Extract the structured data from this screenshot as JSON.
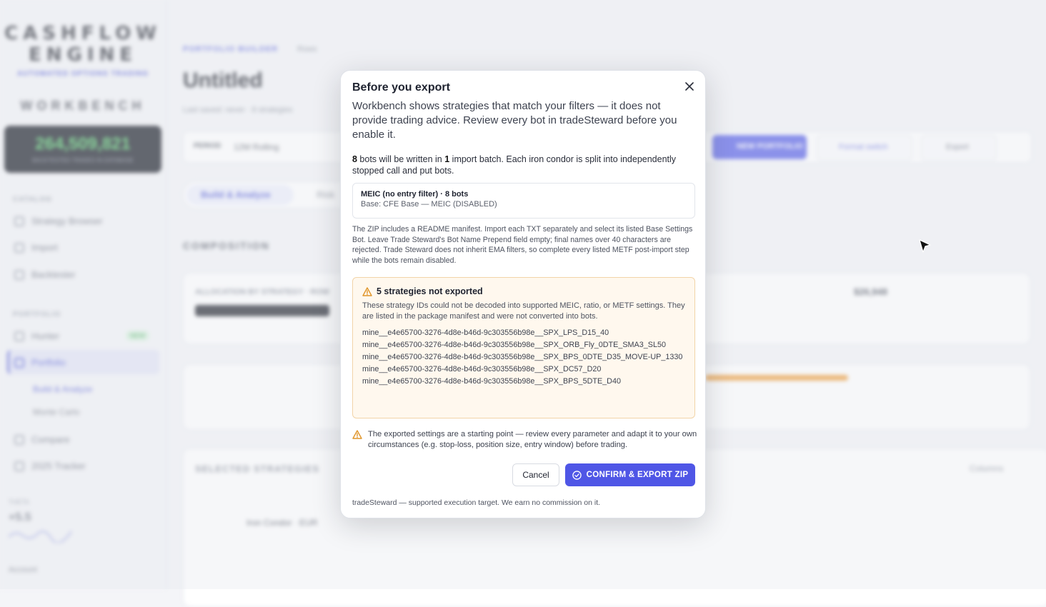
{
  "sidebar": {
    "logo_line1": "CASHFLOW",
    "logo_line2": "ENGINE",
    "logo_tag": "AUTOMATED OPTIONS TRADING",
    "workbench": "WORKBENCH",
    "counter_value": "264,509,821",
    "counter_sub": "BACKTESTED TRADES IN DATABASE",
    "section_catalog": "CATALOG",
    "section_portfolio": "PORTFOLIO",
    "items": [
      {
        "label": "Strategy Browser"
      },
      {
        "label": "Import"
      },
      {
        "label": "Backtester"
      },
      {
        "label": "Hunter"
      },
      {
        "label": "Portfolio"
      },
      {
        "label": "Compare"
      },
      {
        "label": "2025 Tracker"
      }
    ],
    "sub_items": [
      "Build & Analyze",
      "Monte Carlo"
    ],
    "new_badge": "NEW",
    "theta_label": "THETA",
    "theta_value": "+5.5",
    "account_label": "Account"
  },
  "main": {
    "breadcrumb": "PORTFOLIO BUILDER",
    "breadcrumb_sub": "Rows",
    "title": "Untitled",
    "meta": "Last saved: never · 8 strategies",
    "toolbar_period_label": "PERIOD",
    "toolbar_period_value": "12M Rolling",
    "toolbar_new_portfolio": "NEW PORTFOLIO",
    "toolbar_format": "Format switch",
    "toolbar_export": "Export",
    "tab_build": "Build & Analyze",
    "tab_other": "Risk",
    "section_composition": "COMPOSITION",
    "allocation_label": "ALLOCATION BY STRATEGY · ROW",
    "allocation_total": "$26,948",
    "section_selected": "SELECTED STRATEGIES",
    "columns_btn": "Columns",
    "row_group": "Iron Condor · EUR"
  },
  "modal": {
    "title": "Before you export",
    "lead": "Workbench shows strategies that match your filters — it does not provide trading advice. Review every bot in tradeSteward before you enable it.",
    "bot_count": "8",
    "batch_count": "1",
    "batch_text_1": " bots will be written in ",
    "batch_text_2": " import batch. Each iron condor is split into independently stopped call and put bots.",
    "bot_name": "MEIC (no entry filter) · 8 bots",
    "bot_base": "Base: CFE Base — MEIC (DISABLED)",
    "zip_note": "The ZIP includes a README manifest. Import each TXT separately and select its listed Base Settings Bot. Leave Trade Steward's Bot Name Prepend field empty; final names over 40 characters are rejected. Trade Steward does not inherit EMA filters, so complete every listed METF post-import step while the bots remain disabled.",
    "warn_title": "5 strategies not exported",
    "warn_desc": "These strategy IDs could not be decoded into supported MEIC, ratio, or METF settings. They are listed in the package manifest and were not converted into bots.",
    "not_exported": [
      "mine__e4e65700-3276-4d8e-b46d-9c303556b98e__SPX_LPS_D15_40",
      "mine__e4e65700-3276-4d8e-b46d-9c303556b98e__SPX_ORB_Fly_0DTE_SMA3_SL50",
      "mine__e4e65700-3276-4d8e-b46d-9c303556b98e__SPX_BPS_0DTE_D35_MOVE-UP_1330",
      "mine__e4e65700-3276-4d8e-b46d-9c303556b98e__SPX_DC57_D20",
      "mine__e4e65700-3276-4d8e-b46d-9c303556b98e__SPX_BPS_5DTE_D40"
    ],
    "disclaimer": "The exported settings are a starting point — review every parameter and adapt it to your own circumstances (e.g. stop-loss, position size, entry window) before trading.",
    "cancel_label": "Cancel",
    "confirm_label": "CONFIRM & EXPORT ZIP",
    "footer": "tradeSteward — supported execution target. We earn no commission on it.",
    "colors": {
      "primary": "#4f56e6",
      "warning_bg": "#fff8ee",
      "warning_border": "#f2d4a8",
      "warning_icon": "#e0952a"
    }
  }
}
